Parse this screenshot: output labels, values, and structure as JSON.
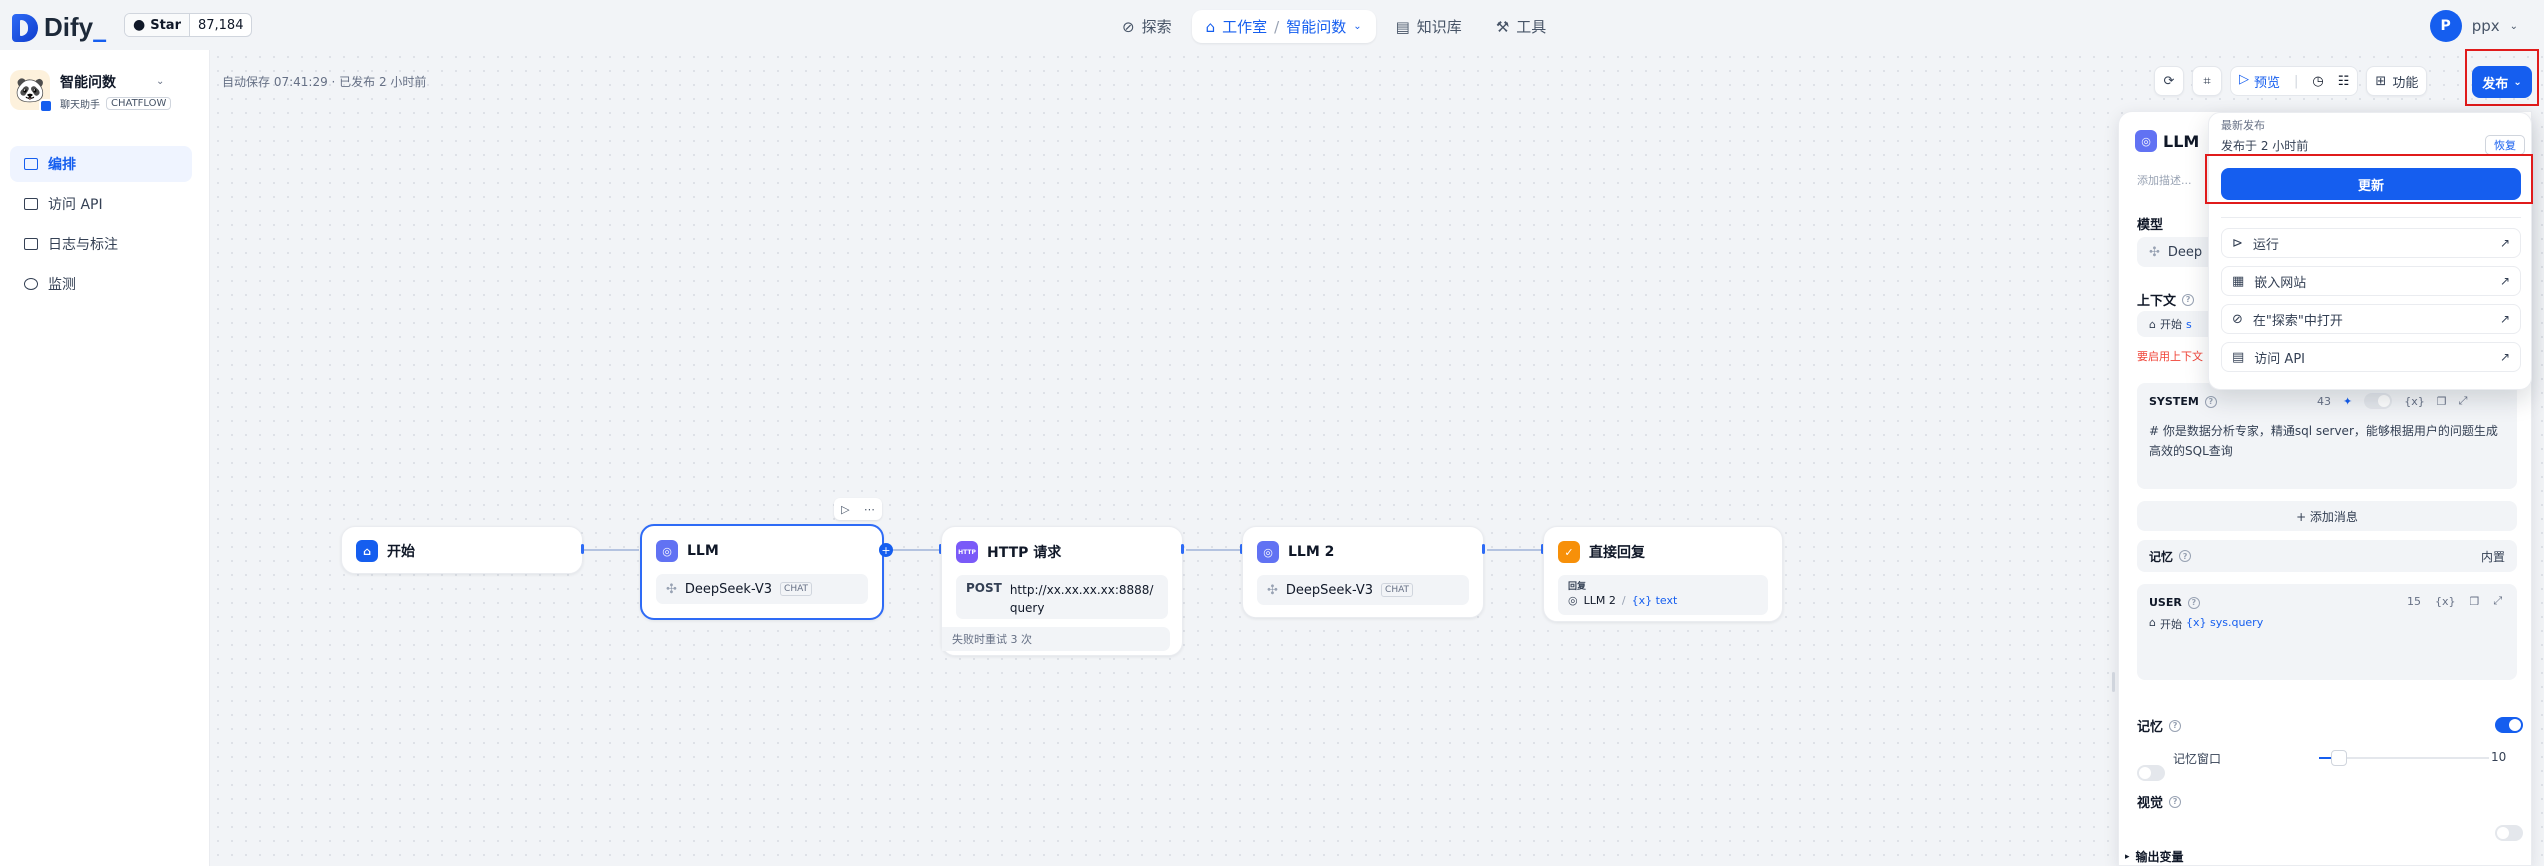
{
  "header": {
    "brand": "Dify",
    "github": {
      "label": "Star",
      "count": "87,184"
    },
    "nav": [
      {
        "label": "探索"
      },
      {
        "label": "工作室"
      },
      {
        "label": "智能问数"
      },
      {
        "label": "知识库"
      },
      {
        "label": "工具"
      }
    ],
    "user": {
      "initial": "P",
      "name": "ppx"
    }
  },
  "sidebar": {
    "app": {
      "name": "智能问数",
      "type": "聊天助手",
      "mode": "CHATFLOW"
    },
    "items": [
      {
        "label": "编排"
      },
      {
        "label": "访问 API"
      },
      {
        "label": "日志与标注"
      },
      {
        "label": "监测"
      }
    ]
  },
  "canvas": {
    "autosave": "自动保存 07:41:29 · 已发布 2 小时前",
    "nodes": {
      "start": {
        "title": "开始"
      },
      "llm": {
        "title": "LLM",
        "model": "DeepSeek-V3",
        "mode": "CHAT"
      },
      "http": {
        "title": "HTTP 请求",
        "method": "POST",
        "url": "http://xx.xx.xx.xx:8888/query",
        "retry": "失败时重试 3 次",
        "icon_label": "HTTP"
      },
      "llm2": {
        "title": "LLM 2",
        "model": "DeepSeek-V3",
        "mode": "CHAT"
      },
      "answer": {
        "title": "直接回复",
        "label": "回复",
        "ref_node": "LLM 2",
        "ref_var": "{x} text"
      }
    }
  },
  "toolbar": {
    "preview": "预览",
    "features": "功能",
    "publish": "发布"
  },
  "panel": {
    "title": "LLM",
    "desc_placeholder": "添加描述...",
    "model_label": "模型",
    "model_value": "Deep",
    "context_label": "上下文",
    "context_value": "开始",
    "context_var": "s",
    "context_warn": "要启用上下文",
    "system_label": "SYSTEM",
    "system_count": "43",
    "system_text": "# 你是数据分析专家，精通sql server，能够根据用户的问题生成高效的SQL查询",
    "add_message": "+ 添加消息",
    "memory_label": "记忆",
    "memory_value": "内置",
    "user_label": "USER",
    "user_count": "15",
    "user_ref_node": "开始",
    "user_ref_var": "{x} sys.query",
    "memory2_label": "记忆",
    "memory_window": "记忆窗口",
    "memory_window_value": "10",
    "vision_label": "视觉",
    "output_label": "输出变量"
  },
  "publish_menu": {
    "latest": "最新发布",
    "published_at": "发布于 2 小时前",
    "restore": "恢复",
    "update": "更新",
    "items": [
      {
        "label": "运行"
      },
      {
        "label": "嵌入网站"
      },
      {
        "label": "在\"探索\"中打开"
      },
      {
        "label": "访问 API"
      }
    ]
  },
  "colors": {
    "primary": "#155eef",
    "highlight": "#e01b1b"
  }
}
